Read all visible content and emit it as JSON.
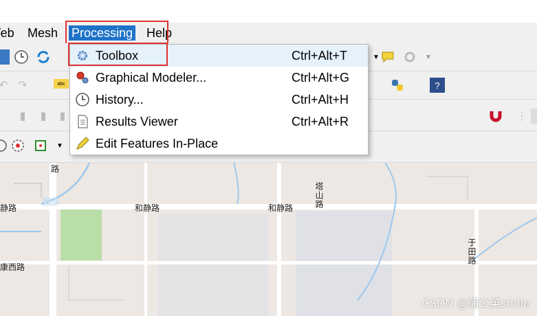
{
  "menubar": {
    "items": [
      {
        "label": "Web"
      },
      {
        "label": "Mesh"
      },
      {
        "label": "Processing"
      },
      {
        "label": "Help"
      }
    ]
  },
  "processing_menu": {
    "items": [
      {
        "label": "Toolbox",
        "shortcut": "Ctrl+Alt+T",
        "icon": "gear-icon"
      },
      {
        "label": "Graphical Modeler...",
        "shortcut": "Ctrl+Alt+G",
        "icon": "modeler-gears-icon"
      },
      {
        "label": "History...",
        "shortcut": "Ctrl+Alt+H",
        "icon": "clock-icon"
      },
      {
        "label": "Results Viewer",
        "shortcut": "Ctrl+Alt+R",
        "icon": "document-icon"
      },
      {
        "label": "Edit Features In-Place",
        "shortcut": "",
        "icon": "pencil-icon"
      }
    ]
  },
  "map": {
    "labels": {
      "hejing_left": "和静路",
      "hejing_mid": "和静路",
      "jing_left": "静路",
      "kang_xi": "康西路",
      "si": "泗泽",
      "ta_shan": "塔山路",
      "yu_tian": "于田路",
      "lu_top": "路"
    }
  },
  "watermark": "CSDN @蒲公英smile",
  "colors": {
    "menu_highlight": "#1e73c8",
    "annotation_red": "#e03030",
    "map_bg": "#ede8e3",
    "water": "#9cc8ee",
    "park": "#b9dfa6"
  }
}
